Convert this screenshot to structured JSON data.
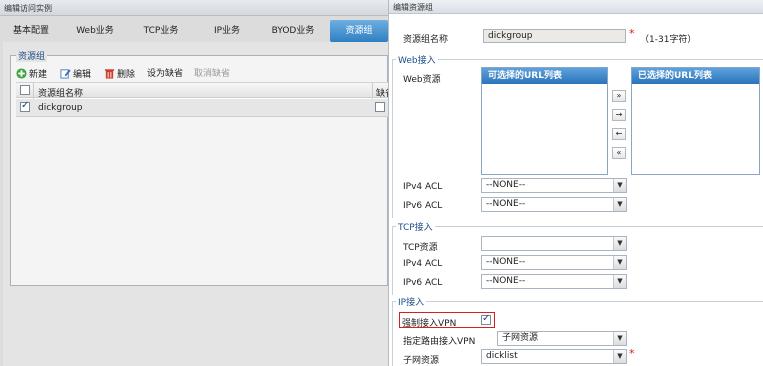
{
  "left_window": {
    "title": "编辑访问实例",
    "tabs": [
      {
        "label": "基本配置"
      },
      {
        "label": "Web业务"
      },
      {
        "label": "TCP业务"
      },
      {
        "label": "IP业务"
      },
      {
        "label": "BYOD业务"
      },
      {
        "label": "资源组"
      }
    ],
    "active_tab": "资源组",
    "group_title": "资源组",
    "toolbar": {
      "new_label": "新建",
      "edit_label": "编辑",
      "delete_label": "删除",
      "set_default_label": "设为缺省",
      "cancel_default_label": "取消缺省"
    },
    "table": {
      "col_name": "资源组名称",
      "col_default": "缺省",
      "rows": [
        {
          "name": "dickgroup",
          "selected": true,
          "default": false
        }
      ]
    }
  },
  "dialog": {
    "title": "编辑资源组",
    "group_name_label": "资源组名称",
    "group_name_value": "dickgroup",
    "group_name_hint": "（1-31字符）",
    "web": {
      "legend": "Web接入",
      "resource_label": "Web资源",
      "available_header": "可选择的URL列表",
      "selected_header": "已选择的URL列表",
      "ipv4_label": "IPv4 ACL",
      "ipv4_value": "--NONE--",
      "ipv6_label": "IPv6 ACL",
      "ipv6_value": "--NONE--"
    },
    "tcp": {
      "legend": "TCP接入",
      "resource_label": "TCP资源",
      "resource_value": "",
      "ipv4_label": "IPv4 ACL",
      "ipv4_value": "--NONE--",
      "ipv6_label": "IPv6 ACL",
      "ipv6_value": "--NONE--"
    },
    "ip": {
      "legend": "IP接入",
      "force_vpn_label": "强制接入VPN",
      "force_vpn_checked": true,
      "route_label": "指定路由接入VPN",
      "route_value": "子网资源",
      "subnet_label": "子网资源",
      "subnet_value": "dicklist"
    },
    "required_mark": "*"
  },
  "colors": {
    "accent": "#2f7fc4",
    "required": "#e01010",
    "highlight_border": "#d92020"
  }
}
